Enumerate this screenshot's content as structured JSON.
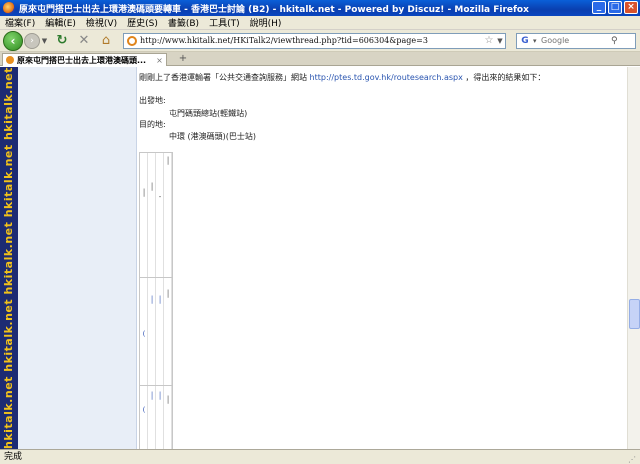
{
  "window": {
    "title": "原來屯門搭巴士出去上環港澳碼頭要轉車 - 香港巴士討論 (B2) - hkitalk.net - Powered by Discuz! - Mozilla Firefox",
    "buttons": [
      "_",
      "□",
      "×"
    ]
  },
  "menu": {
    "items": [
      "檔案(F)",
      "編輯(E)",
      "檢視(V)",
      "歷史(S)",
      "書籤(B)",
      "工具(T)",
      "說明(H)"
    ]
  },
  "nav": {
    "back_icon": "back-arrow-icon",
    "url": "http://www.hkitalk.net/HKiTalk2/viewthread.php?tid=606304&page=3",
    "search_engine": "Google",
    "search_placeholder": "Google"
  },
  "tabs": [
    {
      "title": "原來屯門搭巴士出去上環港澳碼頭...",
      "close": "×"
    }
  ],
  "newtab_label": "+",
  "sidebar": {
    "brand": "hkitalk.net   hkitalk.net   hkitalk.net   hkitalk.net   hkitalk.net"
  },
  "post": {
    "intro": "剛剛上了香港運輸署「公共交通查詢服務」網站",
    "link": "http://ptes.td.gov.hk/routesearch.aspx",
    "intro_tail": "，得出來的結果如下：",
    "origin_label": "出發地:",
    "origin_value": "屯門碼頭總站(輕鐵站)",
    "dest_label": "目的地:",
    "dest_value": "中環 (港澳碼頭)(巴士站)"
  },
  "status": {
    "text": "完成"
  }
}
